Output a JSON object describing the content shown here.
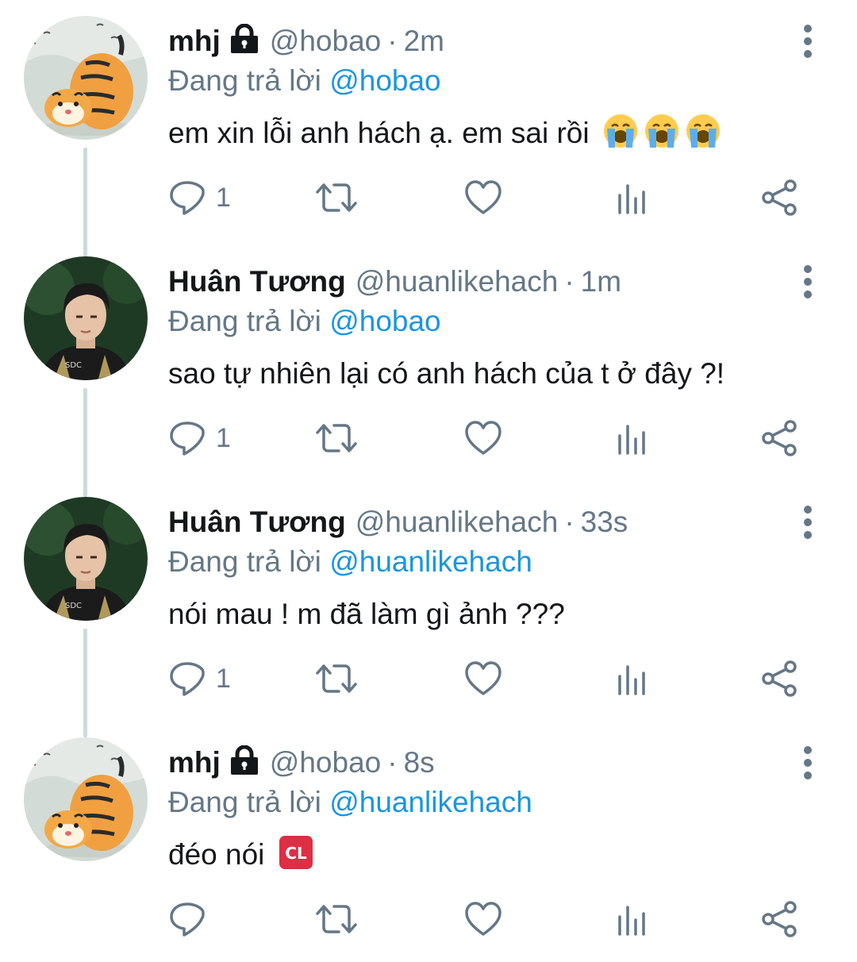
{
  "tweets": [
    {
      "name": "mhj",
      "avatar": "tiger-avatar",
      "locked": true,
      "handle": "@hobao",
      "dot": "·",
      "time": "2m",
      "reply_prefix": "Đang trả lời",
      "reply_to": "@hobao",
      "text": "em xin lỗi anh hách ạ. em sai rồi",
      "emojis": [
        "loudly-crying-face",
        "loudly-crying-face",
        "loudly-crying-face"
      ],
      "reply_count": "1"
    },
    {
      "name": "Huân Tương",
      "avatar": "person-avatar",
      "locked": false,
      "handle": "@huanlikehach",
      "dot": "·",
      "time": "1m",
      "reply_prefix": "Đang trả lời",
      "reply_to": "@hobao",
      "text": "sao tự nhiên lại có anh hách của t ở đây ?!",
      "emojis": [],
      "reply_count": "1"
    },
    {
      "name": "Huân Tương",
      "avatar": "person-avatar",
      "locked": false,
      "handle": "@huanlikehach",
      "dot": "·",
      "time": "33s",
      "reply_prefix": "Đang trả lời",
      "reply_to": "@huanlikehach",
      "text": "nói mau ! m đã làm gì ảnh ???",
      "emojis": [],
      "reply_count": "1"
    },
    {
      "name": "mhj",
      "avatar": "tiger-avatar",
      "locked": true,
      "handle": "@hobao",
      "dot": "·",
      "time": "8s",
      "reply_prefix": "Đang trả lời",
      "reply_to": "@huanlikehach",
      "text": "đéo nói",
      "emojis": [
        "cl-button"
      ],
      "reply_count": ""
    }
  ],
  "emoji_labels": {
    "cl": "CL"
  },
  "icons": {
    "reply": "speech-bubble-icon",
    "retweet": "retweet-icon",
    "like": "heart-icon",
    "analytics": "analytics-icon",
    "share": "share-icon",
    "more": "more-vertical-icon",
    "lock": "lock-icon"
  },
  "colors": {
    "link": "#1b95e0",
    "secondary_text": "#657786",
    "primary_text": "#14171a",
    "thread_line": "#cfd9de"
  }
}
